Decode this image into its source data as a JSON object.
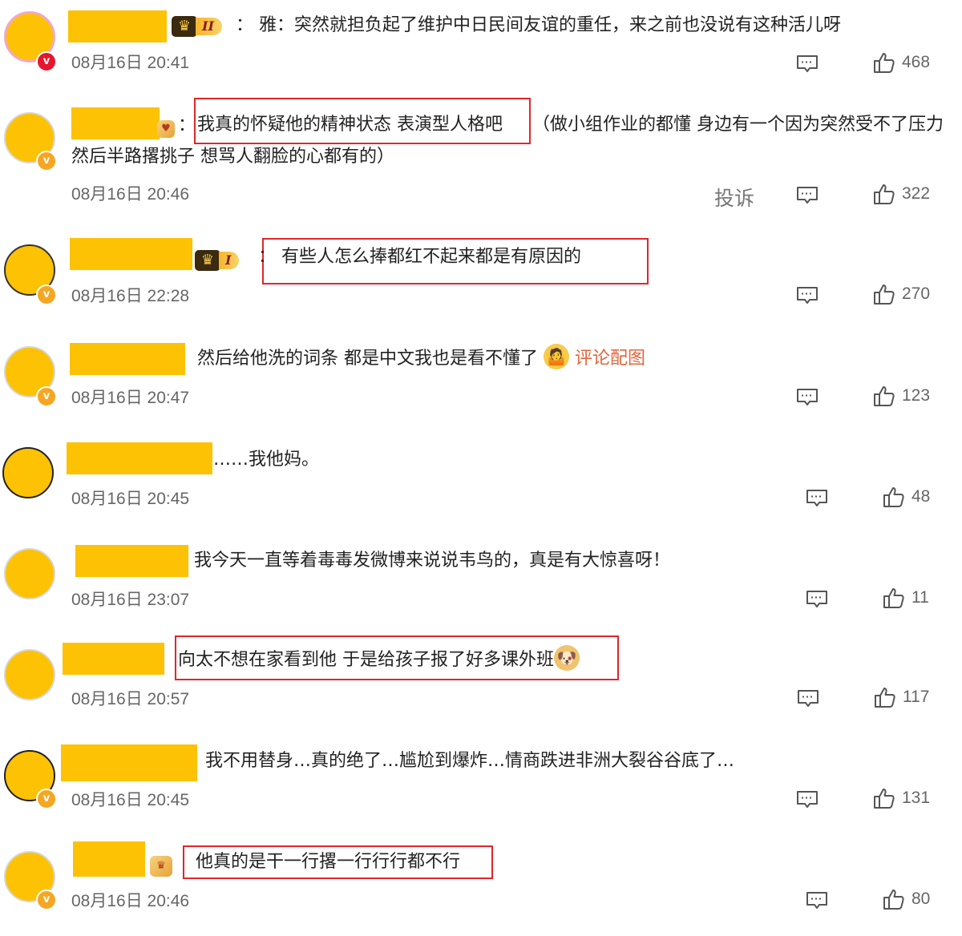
{
  "comments": [
    {
      "rank": "II",
      "text": "：  雅：突然就担负起了维护中日民间友谊的重任，来之前也没说有这种活儿呀",
      "time": "08月16日 20:41",
      "likes": "468"
    },
    {
      "text_boxed": "我真的怀疑他的精神状态 表演型人格吧",
      "text_rest": "（做小组作业的都懂 身边有一个因为突然受不了压力然后半路撂挑子 想骂人翻脸的心都有的）",
      "time": "08月16日 20:46",
      "report": "投诉",
      "likes": "322"
    },
    {
      "rank": "I",
      "text": "：  有些人怎么捧都红不起来都是有原因的",
      "time": "08月16日 22:28",
      "likes": "270"
    },
    {
      "text": "然后给他洗的词条 都是中文我也是看不懂了",
      "image_link": "评论配图",
      "time": "08月16日 20:47",
      "likes": "123"
    },
    {
      "text": "……我他妈。",
      "time": "08月16日 20:45",
      "likes": "48"
    },
    {
      "text": "我今天一直等着毒毒发微博来说说韦鸟的，真是有大惊喜呀！",
      "time": "08月16日 23:07",
      "likes": "11"
    },
    {
      "text": "向太不想在家看到他 于是给孩子报了好多课外班",
      "time": "08月16日 20:57",
      "likes": "117"
    },
    {
      "text": "我不用替身…真的绝了…尴尬到爆炸…情商跌进非洲大裂谷谷底了…",
      "time": "08月16日 20:45",
      "likes": "131"
    },
    {
      "text": "他真的是干一行撂一行行行都不行",
      "time": "08月16日 20:46",
      "likes": "80"
    }
  ],
  "icons": {
    "reply": "comment-bubble-icon",
    "like": "thumbs-up-icon",
    "crown": "crown-icon",
    "verified": "verified-v-icon"
  },
  "colors": {
    "highlight_border": "#e0262a",
    "mask": "#fdc204",
    "image_link": "#e0673d"
  }
}
